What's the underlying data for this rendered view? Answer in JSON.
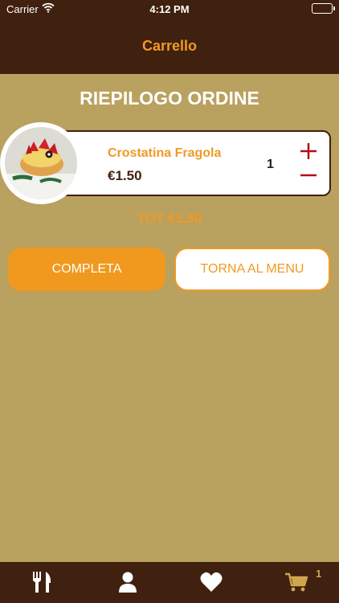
{
  "status_bar": {
    "carrier": "Carrier",
    "time": "4:12 PM"
  },
  "nav": {
    "title": "Carrello"
  },
  "summary_title": "RIEPILOGO ORDINE",
  "items": [
    {
      "name": "Crostatina Fragola",
      "price": "€1.50",
      "quantity": "1"
    }
  ],
  "total": "TOT €1.50",
  "buttons": {
    "complete": "COMPLETA",
    "back_to_menu": "TORNA AL MENU"
  },
  "tab_bar": {
    "cart_badge": "1"
  },
  "colors": {
    "dark_brown": "#40200e",
    "accent_orange": "#f09a26",
    "background": "#b9a15f",
    "stepper_red": "#b20d14"
  },
  "icons": [
    "wifi-icon",
    "battery-icon",
    "plus-icon",
    "minus-icon",
    "fork-knife-icon",
    "user-icon",
    "heart-icon",
    "cart-icon"
  ]
}
